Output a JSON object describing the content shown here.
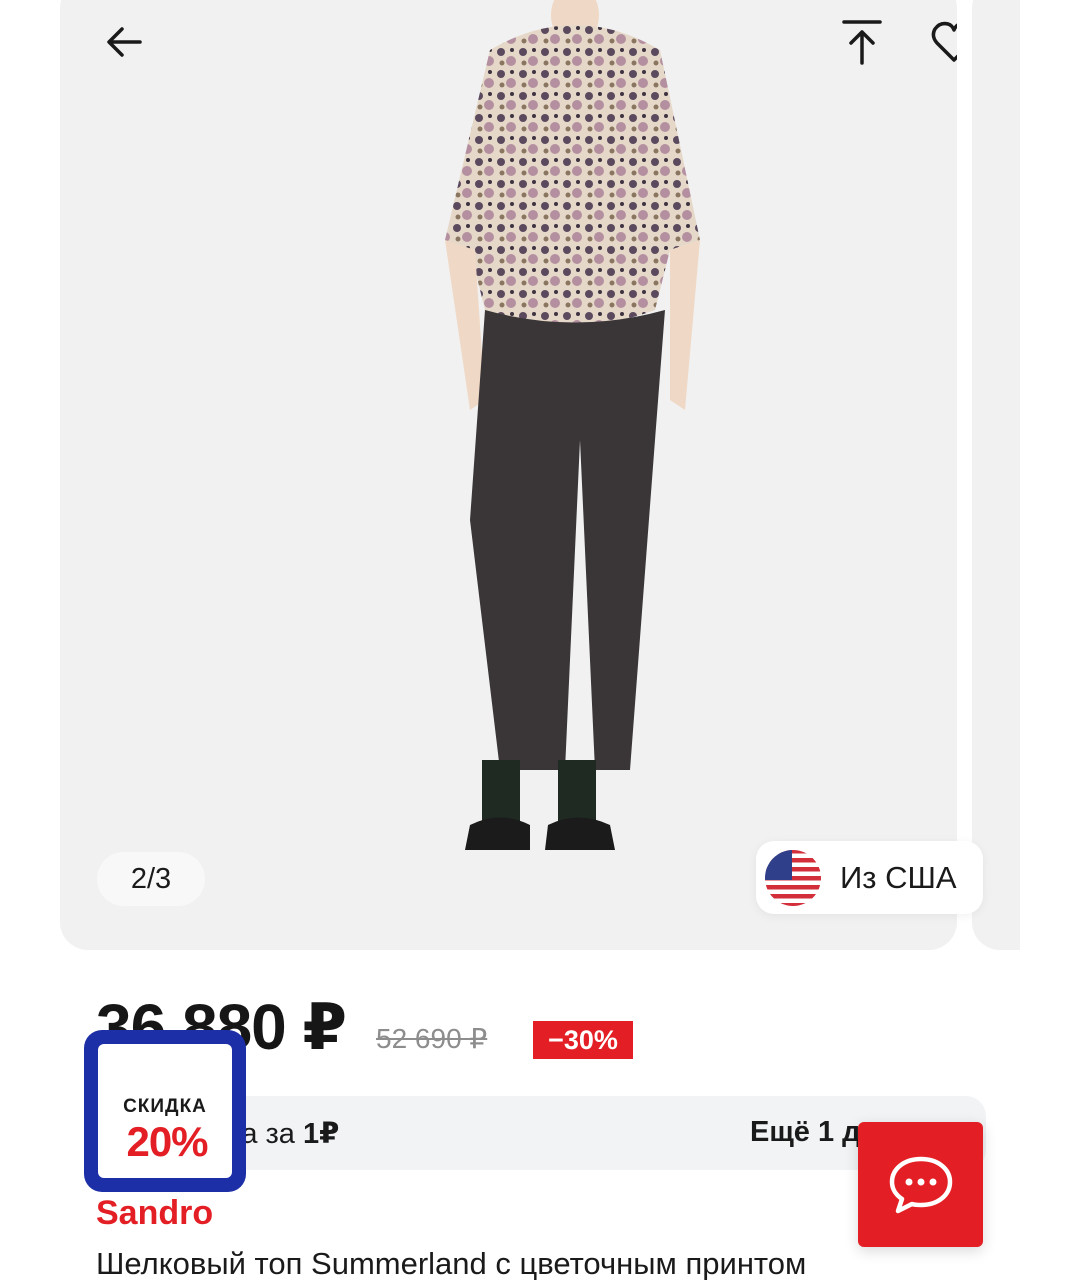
{
  "gallery": {
    "counter": "2/3",
    "origin_label": "Из США",
    "icons": {
      "back": "arrow-left-icon",
      "share": "arrow-up-bar-icon",
      "favorite": "heart-outline-icon",
      "flag": "us-flag-icon"
    }
  },
  "pricing": {
    "price": "36 880 ₽",
    "old_price": "52 690 ₽",
    "discount": "−30%"
  },
  "promo": {
    "left_text": "ка за ",
    "left_bold": "1₽",
    "right_text": "Ещё 1 д"
  },
  "sticker": {
    "label": "СКИДКА",
    "value": "20%"
  },
  "chat": {
    "icon": "chat-bubble-icon"
  },
  "product": {
    "brand": "Sandro",
    "title": "Шелковый топ Summerland с цветочным принтом"
  },
  "colors": {
    "accent_red": "#e31e24",
    "sticker_blue": "#1d2fa6",
    "gallery_bg": "#f1f1f1"
  }
}
